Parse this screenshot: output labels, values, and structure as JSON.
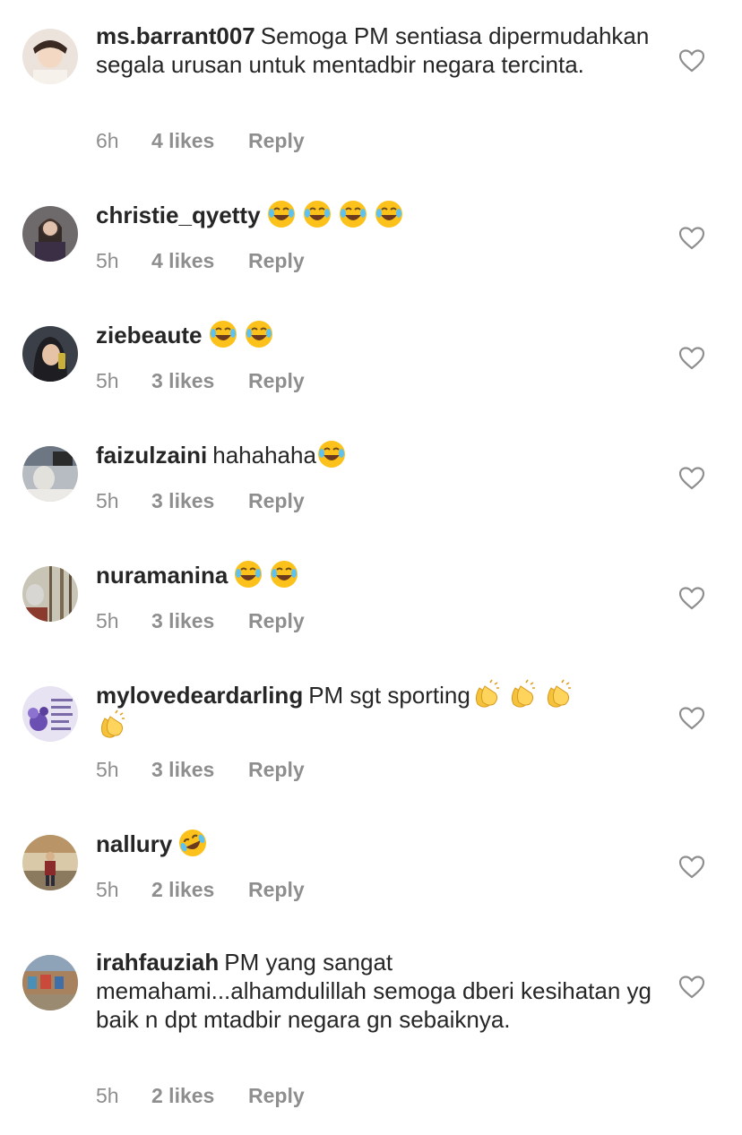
{
  "comments": [
    {
      "username": "ms.barrant007",
      "text": "Semoga PM sentiasa dipermudahkan segala urusan untuk mentadbir negara tercinta.",
      "emojis": [],
      "time": "6h",
      "likes": "4 likes",
      "reply": "Reply",
      "avatar_color": "#e9dfd6"
    },
    {
      "username": "christie_qyetty",
      "text": "",
      "emojis": [
        "face-with-tears-of-joy",
        "face-with-tears-of-joy",
        "face-with-tears-of-joy",
        "face-with-tears-of-joy"
      ],
      "time": "5h",
      "likes": "4 likes",
      "reply": "Reply",
      "avatar_color": "#5b4a52"
    },
    {
      "username": "ziebeaute",
      "text": "",
      "emojis": [
        "face-with-tears-of-joy",
        "face-with-tears-of-joy"
      ],
      "time": "5h",
      "likes": "3 likes",
      "reply": "Reply",
      "avatar_color": "#2f3540"
    },
    {
      "username": "faizulzaini",
      "text": "hahahaha",
      "emojis": [
        "face-with-tears-of-joy"
      ],
      "time": "5h",
      "likes": "3 likes",
      "reply": "Reply",
      "avatar_color": "#9aa0a6"
    },
    {
      "username": "nuramanina",
      "text": "",
      "emojis": [
        "face-with-tears-of-joy",
        "face-with-tears-of-joy"
      ],
      "time": "5h",
      "likes": "3 likes",
      "reply": "Reply",
      "avatar_color": "#7c6a4e"
    },
    {
      "username": "mylovedeardarling",
      "text": "PM sgt sporting",
      "emojis": [
        "clapping-hands",
        "clapping-hands",
        "clapping-hands",
        "clapping-hands"
      ],
      "time": "5h",
      "likes": "3 likes",
      "reply": "Reply",
      "avatar_color": "#6b5aa6"
    },
    {
      "username": "nallury",
      "text": "",
      "emojis": [
        "rolling-on-the-floor-laughing"
      ],
      "time": "5h",
      "likes": "2 likes",
      "reply": "Reply",
      "avatar_color": "#8a6b4d"
    },
    {
      "username": "irahfauziah",
      "text": "PM yang sangat memahami...alhamdulillah semoga dberi kesihatan yg baik n dpt mtadbir negara gn sebaiknya.",
      "emojis": [],
      "time": "5h",
      "likes": "2 likes",
      "reply": "Reply",
      "avatar_color": "#b08a6a"
    }
  ]
}
